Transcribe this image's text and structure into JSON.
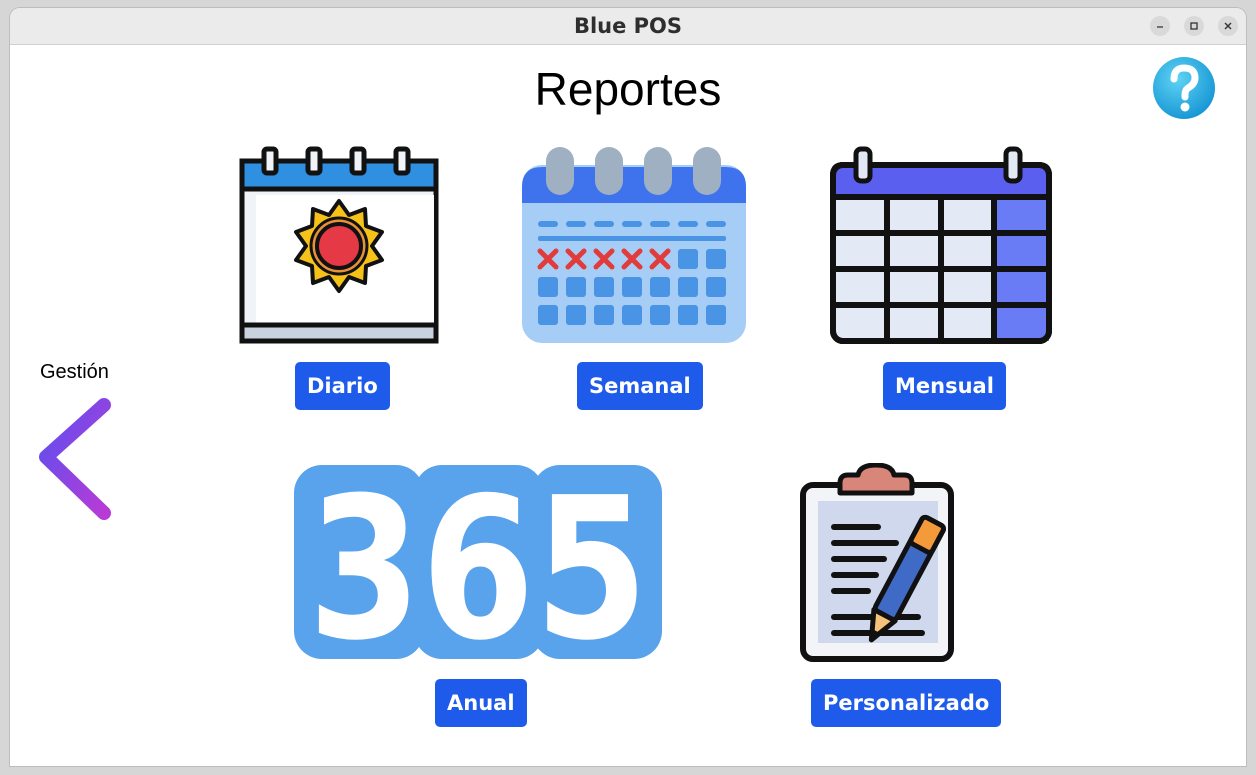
{
  "window": {
    "title": "Blue POS"
  },
  "page": {
    "title": "Reportes"
  },
  "nav": {
    "back_label": "Gestión"
  },
  "reports": {
    "daily": "Diario",
    "weekly": "Semanal",
    "monthly": "Mensual",
    "annual": "Anual",
    "custom": "Personalizado"
  },
  "annual_icon_text": "365",
  "colors": {
    "button": "#1f5bea",
    "annual_icon": "#59a2ec",
    "back_arrow_start": "#6a4de8",
    "back_arrow_end": "#b13bd8",
    "help": "#29abe2"
  },
  "icons": {
    "help": "question-circle-icon",
    "back": "chevron-left-icon",
    "daily": "sun-calendar-icon",
    "weekly": "week-calendar-icon",
    "monthly": "month-calendar-icon",
    "annual": "365-icon",
    "custom": "clipboard-pen-icon"
  }
}
